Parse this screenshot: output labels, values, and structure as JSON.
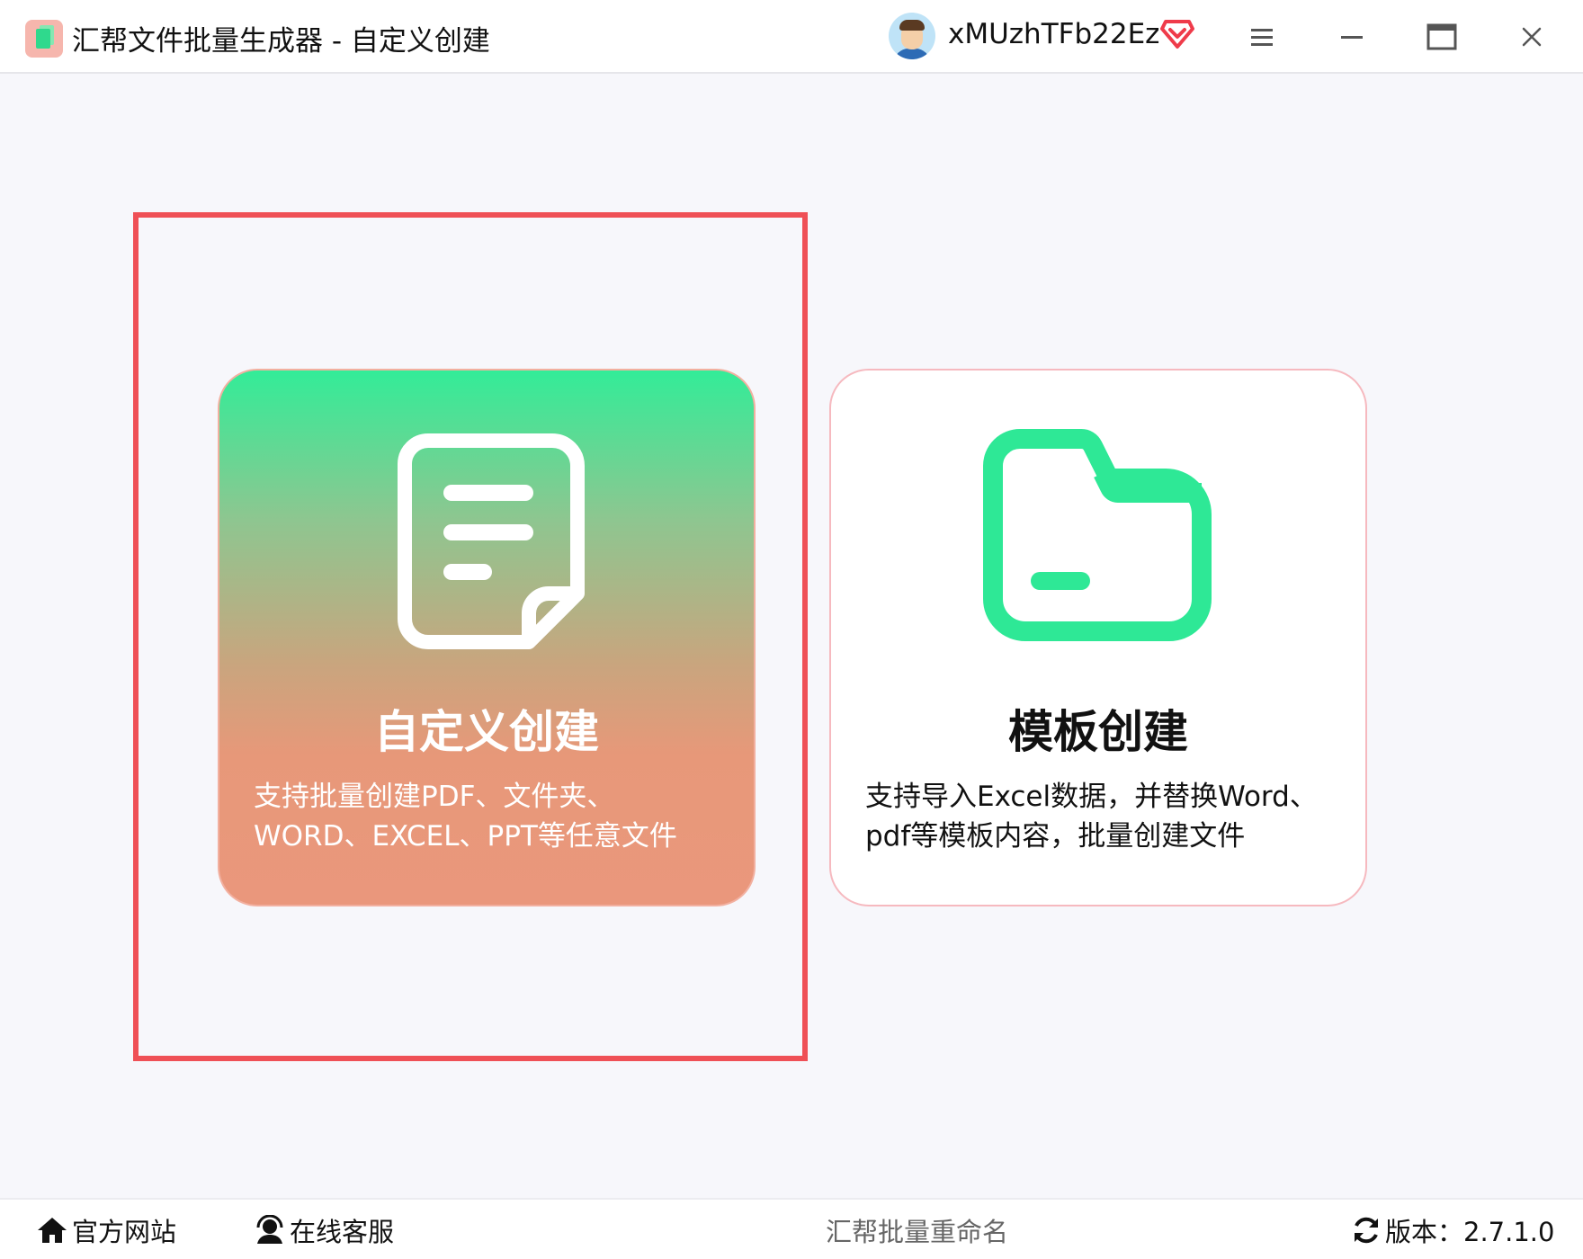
{
  "window": {
    "title": "汇帮文件批量生成器 - 自定义创建",
    "username": "xMUzhTFb22Ez",
    "icons": {
      "app": "app-logo-icon",
      "avatar": "user-avatar",
      "vip": "vip-diamond-icon",
      "menu": "menu-icon",
      "minimize": "minimize-icon",
      "maximize": "maximize-icon",
      "close": "close-icon"
    }
  },
  "cards": [
    {
      "id": "custom",
      "title": "自定义创建",
      "desc_line1": "支持批量创建PDF、文件夹、",
      "desc_line2": "WORD、EXCEL、PPT等任意文件",
      "icon": "document-icon",
      "selected": true
    },
    {
      "id": "template",
      "title": "模板创建",
      "desc_line1": "支持导入Excel数据，并替换Word、",
      "desc_line2": "pdf等模板内容，批量创建文件",
      "icon": "folder-icon",
      "selected": false
    }
  ],
  "footer": {
    "website": "官方网站",
    "service": "在线客服",
    "center": "汇帮批量重命名",
    "version": "版本：2.7.1.0"
  },
  "colors": {
    "accent_green": "#2ee896",
    "selection_red": "#ef5056",
    "vip_red": "#ef3b4a"
  }
}
